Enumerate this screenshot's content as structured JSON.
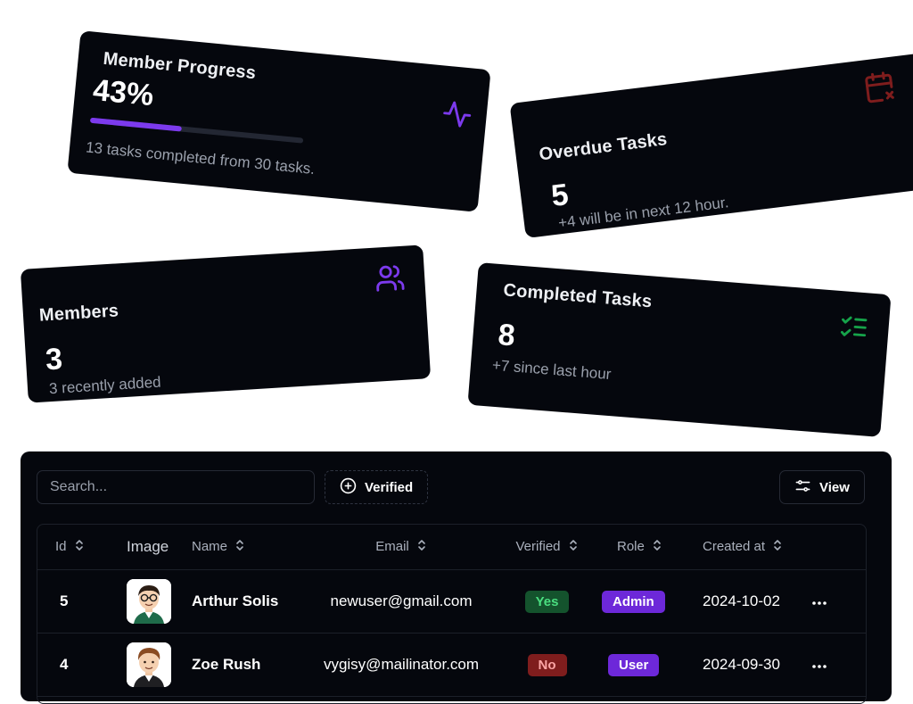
{
  "cards": {
    "progress": {
      "title": "Member Progress",
      "value": "43%",
      "progress": 0.43,
      "subtitle": "13 tasks completed from 30 tasks."
    },
    "overdue": {
      "title": "Overdue Tasks",
      "value": "5",
      "subtitle": "+4 will be in next 12 hour."
    },
    "members": {
      "title": "Members",
      "value": "3",
      "subtitle": "3 recently added"
    },
    "completed": {
      "title": "Completed Tasks",
      "value": "8",
      "subtitle": "+7 since last hour"
    }
  },
  "icons": {
    "progress": "activity-icon",
    "overdue": "calendar-x-icon",
    "members": "users-icon",
    "completed": "list-checks-icon"
  },
  "colors": {
    "accent": "#7c3aed",
    "overdue_icon": "#7f1d1d",
    "completed_icon": "#16a34a",
    "yes_bg": "#14532d",
    "yes_text": "#4ade80",
    "no_bg": "#7f1d1d",
    "no_text": "#fca5a5",
    "role_bg": "#6d28d9"
  },
  "toolbar": {
    "search_placeholder": "Search...",
    "verified_label": "Verified",
    "view_label": "View"
  },
  "table": {
    "columns": {
      "id": "Id",
      "image": "Image",
      "name": "Name",
      "email": "Email",
      "verified": "Verified",
      "role": "Role",
      "created": "Created at"
    },
    "rows": [
      {
        "id": "5",
        "name": "Arthur Solis",
        "email": "newuser@gmail.com",
        "verified": "Yes",
        "role": "Admin",
        "created": "2024-10-02"
      },
      {
        "id": "4",
        "name": "Zoe Rush",
        "email": "vygisy@mailinator.com",
        "verified": "No",
        "role": "User",
        "created": "2024-09-30"
      }
    ]
  }
}
